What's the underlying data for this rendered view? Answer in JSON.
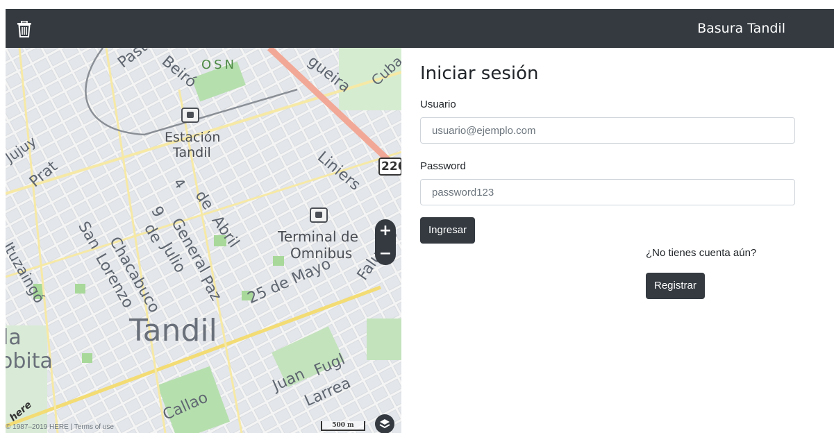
{
  "navbar": {
    "icon": "trash-icon",
    "brand": "Basura Tandil",
    "background": "#343a40"
  },
  "map": {
    "labels": {
      "paste": "Paste",
      "beiro": "Beiró",
      "osn": "OSN",
      "gueira": "gueira",
      "cuba": "Cuba",
      "jujuy": "Jujuy",
      "estacion": "Estación",
      "tandil_station": "Tandil",
      "liniers": "Liniers",
      "prat": "Prat",
      "abril_4": "4",
      "abril_de": "de",
      "abril": "Abril",
      "julio_9": "9",
      "julio_de": "de",
      "julio": "Julio",
      "general": "General",
      "paz": "Paz",
      "ituzaingo": "Ituzaingó",
      "san": "San",
      "lorenzo": "Lorenzo",
      "chacabuco": "Chacabuco",
      "terminal_de": "Terminal de",
      "omnibus": "Omnibus",
      "mayo": "25 de Mayo",
      "falucho": "Falucho",
      "city": "Tandil",
      "la": "la",
      "obita": "obita",
      "juan": "Juan",
      "fugl": "Fugl",
      "larrea": "Larrea",
      "callao": "Callao"
    },
    "route": "226",
    "zoom_in": "+",
    "zoom_out": "−",
    "copyright": "© 1987–2019 HERE | Terms of use",
    "scale": "500 m",
    "logo": "here",
    "layers_icon": "layers-icon"
  },
  "login": {
    "title": "Iniciar sesión",
    "user_label": "Usuario",
    "user_placeholder": "usuario@ejemplo.com",
    "password_label": "Password",
    "password_placeholder": "password123",
    "submit_label": "Ingresar",
    "no_account_text": "¿No tienes cuenta aún?",
    "register_label": "Registrar"
  }
}
